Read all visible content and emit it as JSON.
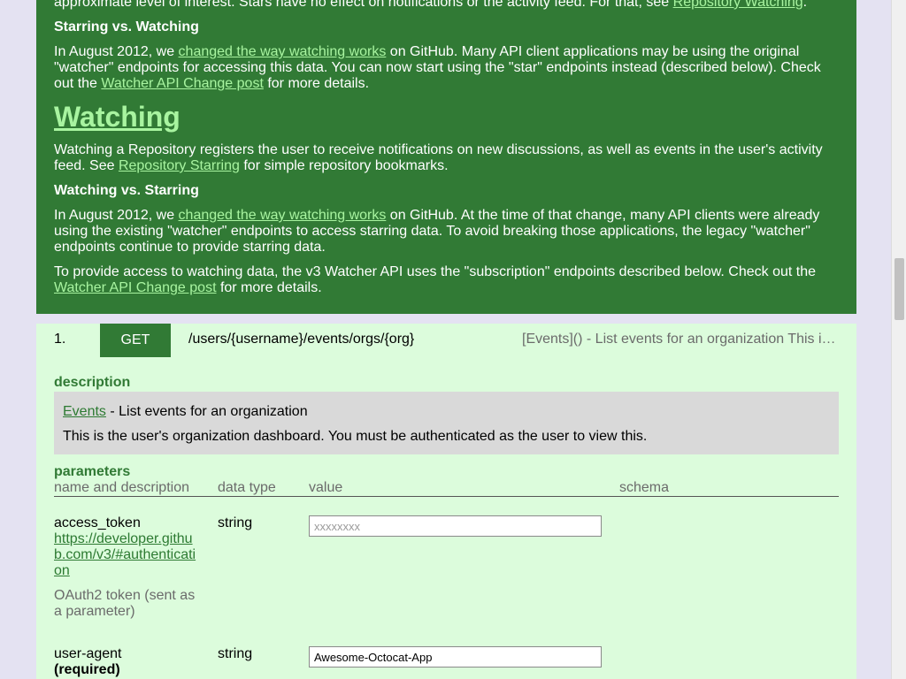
{
  "green": {
    "intro_text": "approximate level of interest. Stars have no effect on notifications or the activity feed. For that, see ",
    "intro_link": "Repository Watching",
    "intro_end": ".",
    "h_starring": "Starring vs. Watching",
    "p1_a": "In August 2012, we ",
    "p1_link1": "changed the way watching works",
    "p1_b": " on GitHub. Many API client applications may be using the original \"watcher\" endpoints for accessing this data. You can now start using the \"star\" endpoints instead (described below). Check out the ",
    "p1_link2": "Watcher API Change post",
    "p1_c": " for more details.",
    "h_watching": "Watching",
    "p2_a": "Watching a Repository registers the user to receive notifications on new discussions, as well as events in the user's activity feed. See ",
    "p2_link": "Repository Starring",
    "p2_b": " for simple repository bookmarks.",
    "h_watching_vs": "Watching vs. Starring",
    "p3_a": "In August 2012, we ",
    "p3_link": "changed the way watching works",
    "p3_b": " on GitHub. At the time of that change, many API clients were already using the existing \"watcher\" endpoints to access starring data. To avoid breaking those applications, the legacy \"watcher\" endpoints continue to provide starring data.",
    "p4_a": "To provide access to watching data, the v3 Watcher API uses the \"subscription\" endpoints described below. Check out the ",
    "p4_link": "Watcher API Change post",
    "p4_b": " for more details."
  },
  "endpoint": {
    "number": "1.",
    "method": "GET",
    "path": "/users/{username}/events/orgs/{org}",
    "summary": "[Events]() - List events for an organization This is the user's organization dashboard. You must be authenticated as the user to view this.",
    "description_label": "description",
    "desc_link": "Events",
    "desc_line1_rest": " - List events for an organization",
    "desc_line2": "This is the user's organization dashboard. You must be authenticated as the user to view this.",
    "parameters_label": "parameters",
    "columns": [
      "name and description",
      "data type",
      "value",
      "schema"
    ],
    "params": [
      {
        "name": "access_token",
        "link": "https://developer.github.com/v3/#authentication",
        "description": "OAuth2 token (sent as a parameter)",
        "type": "string",
        "placeholder": "xxxxxxxx",
        "value": ""
      },
      {
        "name": "user-agent",
        "required": "(required)",
        "type": "string",
        "placeholder": "",
        "value": "Awesome-Octocat-App"
      }
    ]
  },
  "colors": {
    "green_bg": "#317a35",
    "endpoint_bg": "#dcfcdc",
    "link_light": "#a8f4a0",
    "link_dark": "#2d7a32",
    "desc_bg": "#d9d9d9"
  }
}
